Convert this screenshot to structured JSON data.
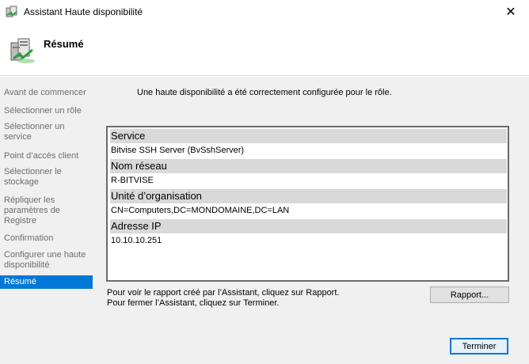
{
  "window": {
    "title": "Assistant Haute disponibilité",
    "close_glyph": "✕",
    "icon": "failover-cluster-icon"
  },
  "header": {
    "page_title": "Résumé",
    "icon": "wizard-summary-icon"
  },
  "sidebar": {
    "steps": [
      {
        "label": "Avant de commencer"
      },
      {
        "label": "Sélectionner un rôle"
      },
      {
        "label": "Sélectionner un service"
      },
      {
        "label": "Point d’accès client"
      },
      {
        "label": "Sélectionner le stockage"
      },
      {
        "label": "Répliquer les paramètres de Registre"
      },
      {
        "label": "Confirmation"
      },
      {
        "label": "Configurer une haute disponibilité"
      },
      {
        "label": "Résumé",
        "active": true
      }
    ]
  },
  "main": {
    "intro": "Une haute disponibilité a été correctement configurée pour le rôle.",
    "summary": [
      {
        "header": "Service",
        "value": "Bitvise SSH Server (BvSshServer)"
      },
      {
        "header": "Nom réseau",
        "value": "R-BITVISE"
      },
      {
        "header": "Unité d’organisation",
        "value": "CN=Computers,DC=MONDOMAINE,DC=LAN"
      },
      {
        "header": "Adresse IP",
        "value": "10.10.10.251"
      }
    ],
    "hint_report": "Pour voir le rapport créé par l’Assistant, cliquez sur Rapport.",
    "hint_close": "Pour fermer l’Assistant, cliquez sur Terminer.",
    "report_button": "Rapport...",
    "finish_button": "Terminer"
  },
  "colors": {
    "accent": "#0078d7",
    "panel": "#f0f0f0",
    "row_header": "#d9d9d9"
  }
}
